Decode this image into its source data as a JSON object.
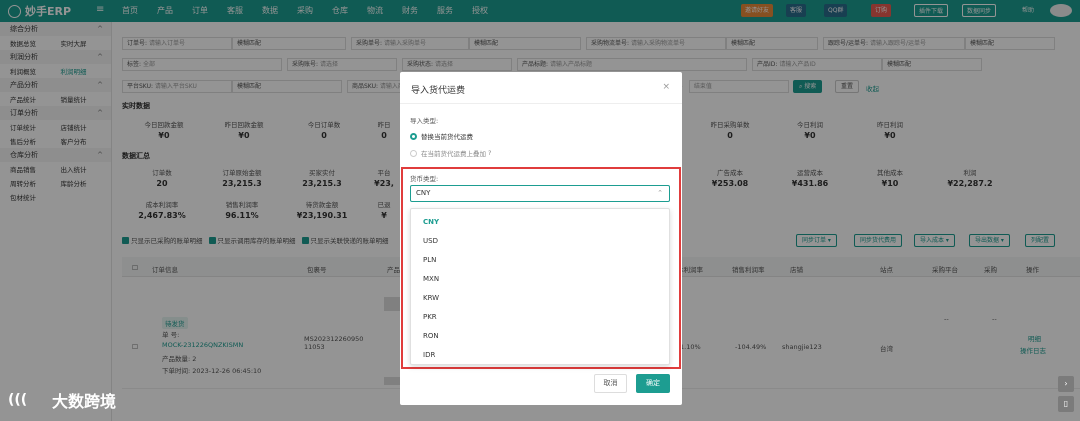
{
  "app": {
    "title": "妙手ERP"
  },
  "topnav": [
    "首页",
    "产品",
    "订单",
    "客服",
    "数据",
    "采购",
    "仓库",
    "物流",
    "财务",
    "服务",
    "授权"
  ],
  "topbar_right": {
    "invite": "邀请好友",
    "support": "客服",
    "qq_group": "QQ群",
    "order_btn": "订购",
    "plugin": "插件下载",
    "sync": "数据同步",
    "help": "帮助"
  },
  "sidebar": {
    "groups": [
      {
        "label": "综合分析",
        "items": [
          "数据总览",
          "实时大屏"
        ]
      },
      {
        "label": "利润分析",
        "items": [
          "利润概览",
          "利润明细"
        ]
      },
      {
        "label": "产品分析",
        "items": [
          "产品统计",
          "销量统计"
        ]
      },
      {
        "label": "订单分析",
        "items": [
          "订单统计",
          "店铺统计",
          "售后分析",
          "客户分布"
        ]
      },
      {
        "label": "仓库分析",
        "items": [
          "商品销售",
          "出入统计",
          "周转分析",
          "库龄分析",
          "包材统计"
        ]
      }
    ],
    "active_item": "利润明细"
  },
  "filters": {
    "row1": [
      {
        "label": "订单号:",
        "placeholder": "请输入订单号",
        "match": "模糊匹配"
      },
      {
        "label": "采购单号:",
        "placeholder": "请输入采购单号",
        "match": "模糊匹配"
      },
      {
        "label": "采购物流单号:",
        "placeholder": "请输入采购物流单号",
        "match": "模糊匹配"
      },
      {
        "label": "跟踪号/运单号:",
        "placeholder": "请输入跟踪号/运单号",
        "match": "模糊匹配"
      }
    ],
    "row2": [
      {
        "label": "标签:",
        "placeholder": "全部"
      },
      {
        "label": "采购账号:",
        "placeholder": "请选择"
      },
      {
        "label": "采购状态:",
        "placeholder": "请选择"
      },
      {
        "label": "产品标题:",
        "placeholder": "请输入产品标题"
      },
      {
        "label": "产品ID:",
        "placeholder": "请输入产品ID",
        "match": "模糊匹配"
      }
    ],
    "row3": [
      {
        "label": "平台SKU:",
        "placeholder": "请输入平台SKU",
        "match": "模糊匹配"
      },
      {
        "label": "商品SKU:",
        "placeholder": "请输入商品SKU"
      }
    ],
    "range_sep": "~",
    "range_end": "结束值",
    "search_btn": "搜索",
    "reset_btn": "重置",
    "collapse_btn": "收起"
  },
  "realtime": {
    "title": "实时数据",
    "stats": [
      {
        "k": "今日回款金额",
        "v": "¥0"
      },
      {
        "k": "昨日回款金额",
        "v": "¥0"
      },
      {
        "k": "今日订单数",
        "v": "0"
      },
      {
        "k": "昨日",
        "v": "0"
      },
      {
        "k": "昨日采购单数",
        "v": "0"
      },
      {
        "k": "今日利润",
        "v": "¥0"
      },
      {
        "k": "昨日利润",
        "v": "¥0"
      }
    ]
  },
  "summary": {
    "title": "数据汇总",
    "row1": [
      {
        "k": "订单数",
        "v": "20"
      },
      {
        "k": "订单原始金额",
        "v": "23,215.3"
      },
      {
        "k": "买家实付",
        "v": "23,215.3"
      },
      {
        "k": "平台",
        "v": "¥23,"
      },
      {
        "k": "广告成本",
        "v": "¥253.08"
      },
      {
        "k": "运营成本",
        "v": "¥431.86"
      },
      {
        "k": "其他成本",
        "v": "¥10"
      },
      {
        "k": "利润",
        "v": "¥22,287.2"
      }
    ],
    "row2": [
      {
        "k": "成本利润率",
        "v": "2,467.83%"
      },
      {
        "k": "销售利润率",
        "v": "96.11%"
      },
      {
        "k": "待货款金额",
        "v": "¥23,190.31"
      },
      {
        "k": "已退",
        "v": "¥"
      }
    ]
  },
  "checkboxes": [
    "只显示已采购的账单明细",
    "只显示调用库存的账单明细",
    "只显示关联快递的账单明细"
  ],
  "action_buttons": [
    "同步订单",
    "同步货代费用",
    "导入成本",
    "导出数据",
    "列配置"
  ],
  "table": {
    "headers": [
      "订单信息",
      "包裹号",
      "产品",
      "本利润率",
      "销售利润率",
      "店铺",
      "站点",
      "采购平台",
      "采购",
      "操作"
    ],
    "row": {
      "tag": "待发货",
      "order_label": "单 号:",
      "order_no": "MOCK-231226QNZKISMN",
      "product_count": "产品数量: 2",
      "order_time": "下单时间: 2023-12-26 06:45:10",
      "package_no": "MS202312260950 11053",
      "cost_margin": "1.10%",
      "sales_margin": "-104.49%",
      "shop": "shangjie123",
      "site": "台湾",
      "purchase_platform": "--",
      "purchase": "--",
      "op1": "明细",
      "op2": "操作日志"
    }
  },
  "modal": {
    "title": "导入货代运费",
    "close": "×",
    "import_type_label": "导入类型:",
    "radio_replace": "替换当前货代运费",
    "radio_add": "在当前货代运费上叠加",
    "currency_label": "货币类型:",
    "currency_selected": "CNY",
    "currency_options": [
      "CNY",
      "USD",
      "PLN",
      "MXN",
      "KRW",
      "PKR",
      "RON",
      "IDR"
    ],
    "cancel": "取消",
    "confirm": "确定"
  },
  "watermark": "大数跨境",
  "colors": {
    "brand": "#1d9d91",
    "highlight": "#e03c3c",
    "order_btn": "#e85c52"
  }
}
